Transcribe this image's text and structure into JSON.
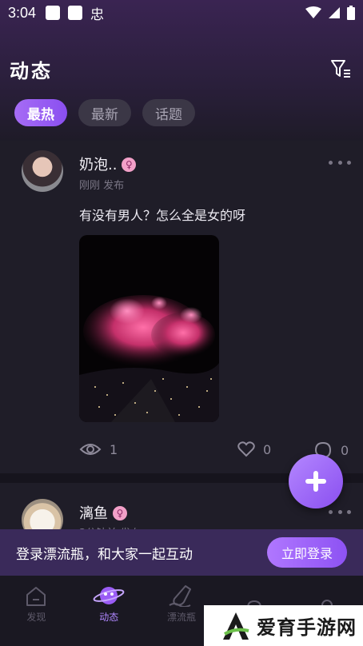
{
  "status_bar": {
    "time": "3:04",
    "bug_glyph": "忠"
  },
  "header": {
    "title": "动态",
    "filter_icon": "filter-icon"
  },
  "tabs": [
    {
      "label": "最热",
      "active": true
    },
    {
      "label": "最新",
      "active": false
    },
    {
      "label": "话题",
      "active": false
    }
  ],
  "posts": [
    {
      "username": "奶泡..",
      "gender_glyph": "♀",
      "meta": "刚刚 发布",
      "text": "有没有男人？怎么全是女的呀",
      "views": "1",
      "likes": "0",
      "comments": "0"
    },
    {
      "username": "漓鱼",
      "gender_glyph": "♀",
      "meta": "3分钟前 发布"
    }
  ],
  "login_banner": {
    "text": "登录漂流瓶，和大家一起互动",
    "button": "立即登录"
  },
  "bottom_nav": [
    {
      "label": "发现",
      "icon": "home-icon"
    },
    {
      "label": "动态",
      "icon": "planet-icon",
      "active": true
    },
    {
      "label": "漂流瓶",
      "icon": "bottle-icon"
    },
    {
      "label": "",
      "icon": "bell-icon"
    },
    {
      "label": "",
      "icon": "user-icon"
    }
  ],
  "watermark": {
    "text": "爱育手游网"
  },
  "colors": {
    "accent": "#9a5cf5",
    "background": "#1c1a24"
  }
}
